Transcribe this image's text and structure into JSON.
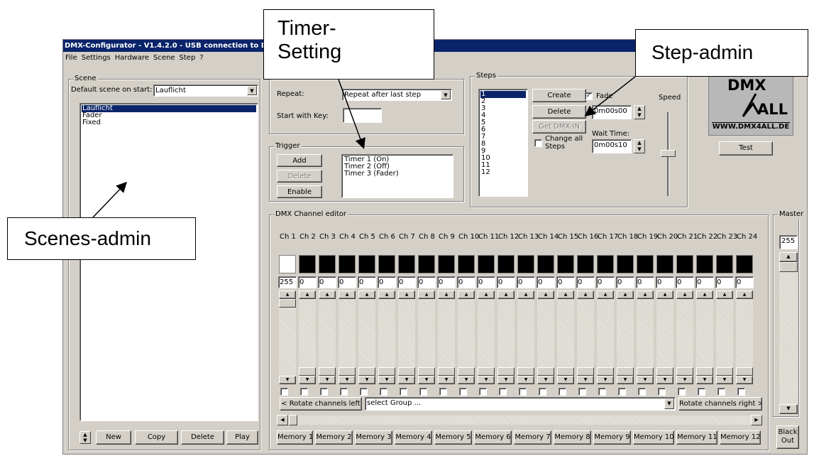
{
  "window": {
    "title": "DMX-Configurator - V1.4.2.0 - USB connection to DMX-",
    "menu": [
      "File",
      "Settings",
      "Hardware",
      "Scene",
      "Step",
      "?"
    ]
  },
  "scene": {
    "group_label": "Scene",
    "default_label": "Default scene on start:",
    "default_value": "Lauflicht",
    "items": [
      "Lauflicht",
      "Fader",
      "Fixed"
    ],
    "selected_index": 0,
    "buttons": {
      "new": "New",
      "copy": "Copy",
      "delete": "Delete",
      "play": "Play"
    }
  },
  "timer": {
    "repeat_label": "Repeat:",
    "repeat_value": "Repeat after last step",
    "start_key_label": "Start with Key:",
    "start_key_value": ""
  },
  "trigger": {
    "group_label": "Trigger",
    "buttons": {
      "add": "Add",
      "delete": "Delete",
      "enable": "Enable"
    },
    "items": [
      "Timer 1 (On)",
      "Timer 2 (Off)",
      "Timer 3 (Fader)"
    ]
  },
  "steps": {
    "group_label": "Steps",
    "items": [
      "1",
      "2",
      "3",
      "4",
      "5",
      "6",
      "7",
      "8",
      "9",
      "10",
      "11",
      "12"
    ],
    "selected_index": 0,
    "buttons": {
      "create": "Create",
      "delete": "Delete",
      "get_dmx": "Get DMX-IN"
    },
    "change_all_label": "Change all Steps",
    "fade_label": "Fade",
    "fade_checked": true,
    "fade_time": "0m00s00",
    "wait_label": "Wait Time:",
    "wait_time": "0m00s10",
    "speed_label": "Speed",
    "test_button": "Test"
  },
  "logo": {
    "line1": "DMX",
    "line2": "ALL",
    "url": "WWW.DMX4ALL.DE"
  },
  "channel_editor": {
    "group_label": "DMX Channel editor",
    "channels": [
      "Ch 1",
      "Ch 2",
      "Ch 3",
      "Ch 4",
      "Ch 5",
      "Ch 6",
      "Ch 7",
      "Ch 8",
      "Ch 9",
      "Ch 10",
      "Ch 11",
      "Ch 12",
      "Ch 13",
      "Ch 14",
      "Ch 15",
      "Ch 16",
      "Ch 17",
      "Ch 18",
      "Ch 19",
      "Ch 20",
      "Ch 21",
      "Ch 22",
      "Ch 23",
      "Ch 24"
    ],
    "values": [
      "255",
      "0",
      "0",
      "0",
      "0",
      "0",
      "0",
      "0",
      "0",
      "0",
      "0",
      "0",
      "0",
      "0",
      "0",
      "0",
      "0",
      "0",
      "0",
      "0",
      "0",
      "0",
      "0",
      "0"
    ],
    "rotate_left": "< Rotate channels left",
    "group_select": "select Group ...",
    "rotate_right": "Rotate channels right >",
    "memories": [
      "Memory 1",
      "Memory 2",
      "Memory 3",
      "Memory 4",
      "Memory 5",
      "Memory 6",
      "Memory 7",
      "Memory 8",
      "Memory 9",
      "Memory 10",
      "Memory 11",
      "Memory 12"
    ]
  },
  "master": {
    "label": "Master",
    "value": "255",
    "blackout": "Black Out"
  },
  "callouts": {
    "timer": "Timer-\nSetting",
    "step": "Step-admin",
    "scenes": "Scenes-admin"
  }
}
